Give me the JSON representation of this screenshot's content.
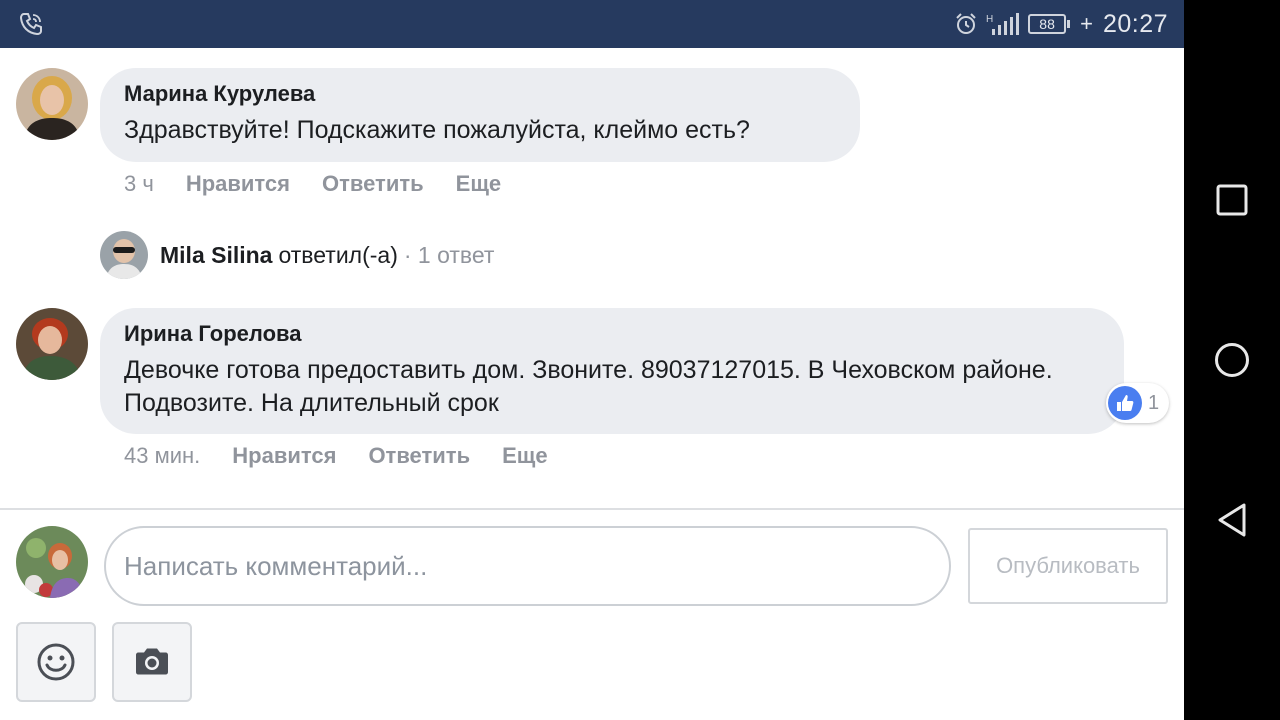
{
  "status_bar": {
    "time": "20:27",
    "battery": "88",
    "network": "H",
    "icons": [
      "call-icon",
      "alarm-icon",
      "signal-icon",
      "battery-icon",
      "charging-icon"
    ]
  },
  "comments": [
    {
      "author": "Марина Курулева",
      "text": "Здравствуйте! Подскажите пожалуйста, клеймо есть?",
      "time": "3 ч",
      "like_label": "Нравится",
      "reply_label": "Ответить",
      "more_label": "Еще"
    },
    {
      "author": "Ирина Горелова",
      "text": "Девочке готова предоставить дом. Звоните. 89037127015. В Чеховском районе. Подвозите. На длительный срок",
      "time": "43 мин.",
      "like_label": "Нравится",
      "reply_label": "Ответить",
      "more_label": "Еще",
      "reactions": "1"
    }
  ],
  "reply_summary": {
    "name": "Mila Silina",
    "verb": "ответил(-а)",
    "count": "· 1 ответ"
  },
  "composer": {
    "placeholder": "Написать комментарий...",
    "publish_label": "Опубликовать",
    "tools": [
      "emoji-icon",
      "camera-icon"
    ]
  },
  "colors": {
    "status_bar": "#263a5f",
    "bubble": "#ebedf1",
    "secondary_text": "#90949c",
    "like_blue": "#4a7ef0"
  }
}
